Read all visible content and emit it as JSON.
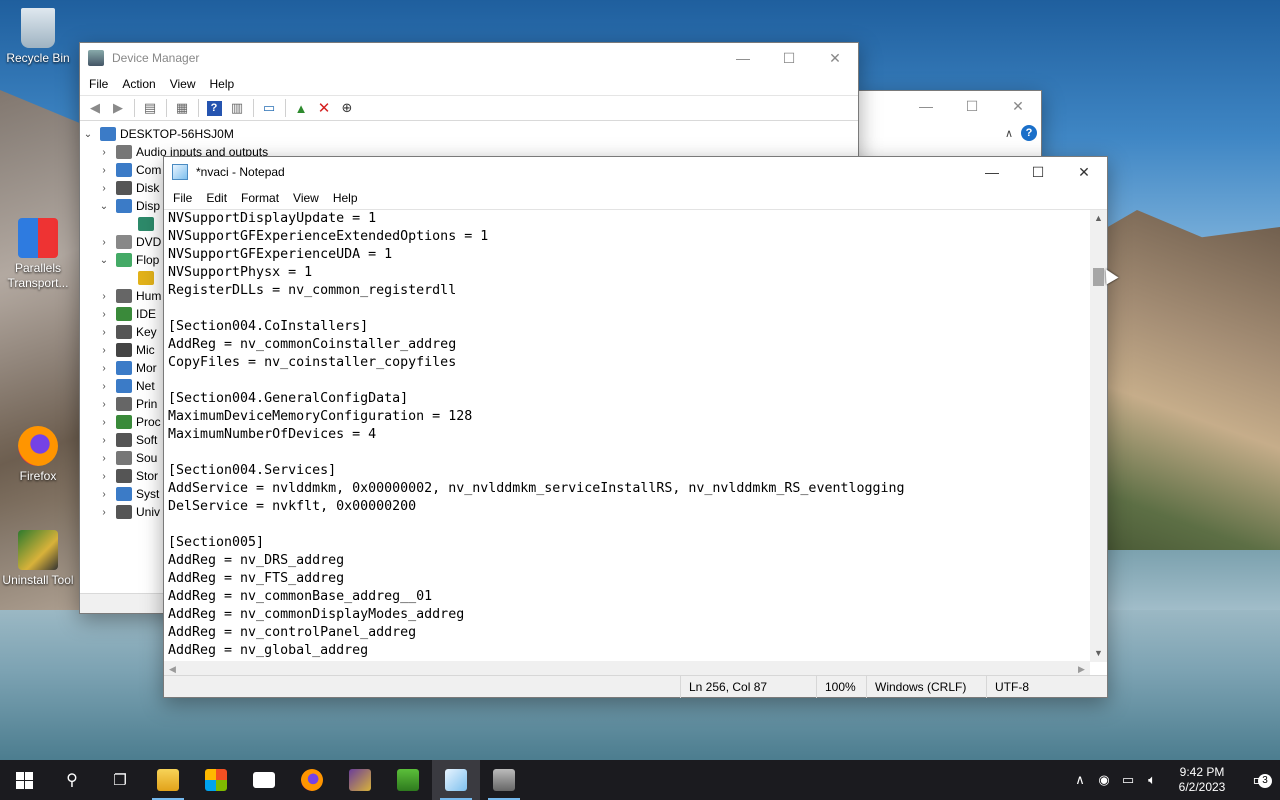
{
  "desktop": {
    "icons": [
      {
        "label": "Recycle Bin"
      },
      {
        "label": "Parallels Transport..."
      },
      {
        "label": "Firefox"
      },
      {
        "label": "Uninstall Tool"
      }
    ]
  },
  "device_manager": {
    "title": "Device Manager",
    "menu": [
      "File",
      "Action",
      "View",
      "Help"
    ],
    "toolbar_icons": [
      "back-icon",
      "forward-icon",
      "properties-icon",
      "update-icon",
      "help-icon",
      "resources-icon",
      "scan-icon",
      "update-driver-icon",
      "uninstall-icon",
      "disable-icon"
    ],
    "tree_root": "DESKTOP-56HSJ0M",
    "tree_items": [
      {
        "label": "Audio inputs and outputs",
        "expanded": false
      },
      {
        "label": "Com",
        "expanded": false
      },
      {
        "label": "Disk",
        "expanded": false
      },
      {
        "label": "Disp",
        "expanded": true
      },
      {
        "label": "",
        "child": true
      },
      {
        "label": "DVD",
        "expanded": false
      },
      {
        "label": "Flop",
        "expanded": true
      },
      {
        "label": "",
        "child": true
      },
      {
        "label": "Hum",
        "expanded": false
      },
      {
        "label": "IDE",
        "expanded": false
      },
      {
        "label": "Key",
        "expanded": false
      },
      {
        "label": "Mic",
        "expanded": false
      },
      {
        "label": "Mor",
        "expanded": false
      },
      {
        "label": "Net",
        "expanded": false
      },
      {
        "label": "Prin",
        "expanded": false
      },
      {
        "label": "Proc",
        "expanded": false
      },
      {
        "label": "Soft",
        "expanded": false
      },
      {
        "label": "Sou",
        "expanded": false
      },
      {
        "label": "Stor",
        "expanded": false
      },
      {
        "label": "Syst",
        "expanded": false
      },
      {
        "label": "Univ",
        "expanded": false
      }
    ]
  },
  "notepad": {
    "title": "*nvaci - Notepad",
    "menu": [
      "File",
      "Edit",
      "Format",
      "View",
      "Help"
    ],
    "lines": [
      "NVSupportDisplayUpdate = 1",
      "NVSupportGFExperienceExtendedOptions = 1",
      "NVSupportGFExperienceUDA = 1",
      "NVSupportPhysx = 1",
      "RegisterDLLs = nv_common_registerdll",
      "",
      "[Section004.CoInstallers]",
      "AddReg = nv_commonCoinstaller_addreg",
      "CopyFiles = nv_coinstaller_copyfiles",
      "",
      "[Section004.GeneralConfigData]",
      "MaximumDeviceMemoryConfiguration = 128",
      "MaximumNumberOfDevices = 4",
      "",
      "[Section004.Services]",
      "AddService = nvlddmkm, 0x00000002, nv_nvlddmkm_serviceInstallRS, nv_nvlddmkm_RS_eventlogging",
      "DelService = nvkflt, 0x00000200",
      "",
      "[Section005]",
      "AddReg = nv_DRS_addreg",
      "AddReg = nv_FTS_addreg",
      "AddReg = nv_commonBase_addreg__01",
      "AddReg = nv_commonDisplayModes_addreg",
      "AddReg = nv_controlPanel_addreg",
      "AddReg = nv_global_addreg"
    ],
    "status": {
      "position": "Ln 256, Col 87",
      "zoom": "100%",
      "line_ending": "Windows (CRLF)",
      "encoding": "UTF-8"
    }
  },
  "taskbar": {
    "apps": [
      "start-icon",
      "search-icon",
      "task-view-icon",
      "file-explorer-icon",
      "store-icon",
      "mail-icon",
      "firefox-icon",
      "winrar-icon",
      "uninstall-tool-icon",
      "notepad-icon",
      "device-manager-icon"
    ],
    "clock": {
      "time": "9:42 PM",
      "date": "6/2/2023"
    },
    "notification_count": "3"
  }
}
